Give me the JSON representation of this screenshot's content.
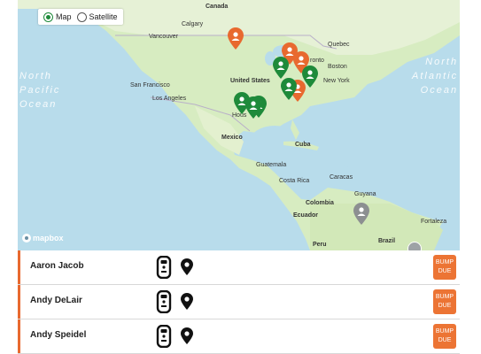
{
  "map": {
    "toggle": {
      "map_label": "Map",
      "satellite_label": "Satellite",
      "selected": "Map"
    },
    "places": {
      "canada": "Canada",
      "calgary": "Calgary",
      "vancouver": "Vancouver",
      "quebec": "Quebec",
      "toronto": "ronto",
      "boston": "Boston",
      "new_york": "New York",
      "united_states": "United States",
      "san_francisco": "San Francisco",
      "los_angeles": "Los Angeles",
      "houston": "Hous",
      "mexico": "Mexico",
      "cuba": "Cuba",
      "guatemala": "Guatemala",
      "costa_rica": "Costa Rica",
      "caracas": "Caracas",
      "guyana": "Guyana",
      "colombia": "Colombia",
      "ecuador": "Ecuador",
      "fortaleza": "Fortaleza",
      "peru": "Peru",
      "brazil": "Brazil"
    },
    "oceans": {
      "north_pacific": [
        "North",
        "Pacific",
        "Ocean"
      ],
      "north_atlantic": [
        "North",
        "Atlantic",
        "Ocean"
      ]
    },
    "attribution": "mapbox",
    "pin_colors": {
      "green": "#1e8a3a",
      "orange": "#e8692f",
      "gray": "#8c8f91"
    }
  },
  "users": [
    {
      "name": "Aaron Jacob",
      "action": "BUMP DUE"
    },
    {
      "name": "Andy DeLair",
      "action": "BUMP DUE"
    },
    {
      "name": "Andy Speidel",
      "action": "BUMP DUE"
    }
  ],
  "icons": {
    "device": "gas-detector-icon",
    "location": "location-pin-icon"
  },
  "colors": {
    "accent": "#e8692f",
    "bump_button": "#ec7434"
  }
}
